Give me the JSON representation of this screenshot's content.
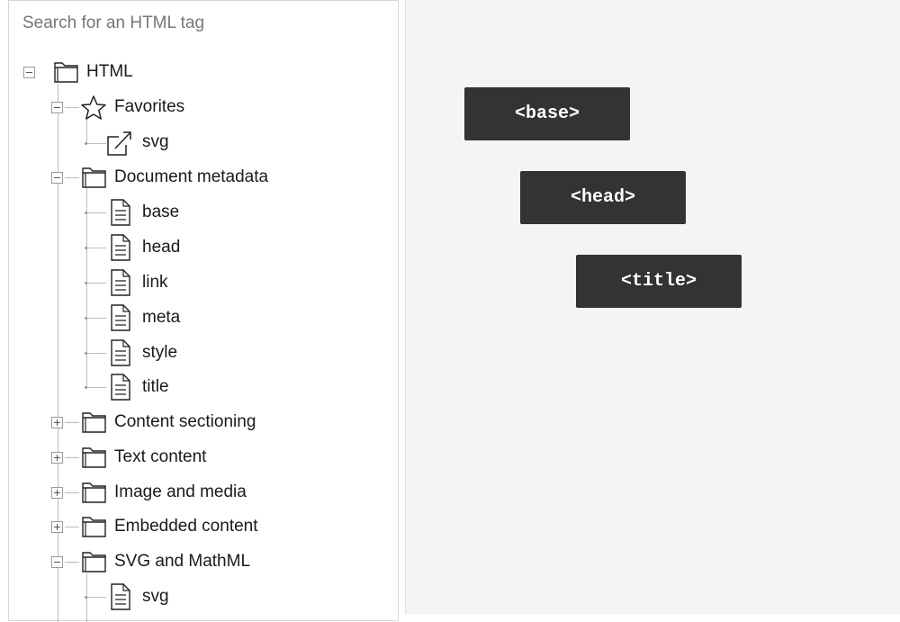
{
  "search": {
    "placeholder": "Search for an HTML tag"
  },
  "tree": {
    "root": {
      "label": "HTML",
      "state": "expanded",
      "icon": "folder-icon"
    },
    "groups": [
      {
        "label": "Favorites",
        "state": "expanded",
        "icon": "star-icon",
        "items": [
          {
            "label": "svg",
            "icon": "share-icon"
          }
        ]
      },
      {
        "label": "Document metadata",
        "state": "expanded",
        "icon": "folder-icon",
        "items": [
          {
            "label": "base",
            "icon": "document-icon"
          },
          {
            "label": "head",
            "icon": "document-icon"
          },
          {
            "label": "link",
            "icon": "document-icon"
          },
          {
            "label": "meta",
            "icon": "document-icon"
          },
          {
            "label": "style",
            "icon": "document-icon"
          },
          {
            "label": "title",
            "icon": "document-icon"
          }
        ]
      },
      {
        "label": "Content sectioning",
        "state": "collapsed",
        "icon": "folder-icon"
      },
      {
        "label": "Text content",
        "state": "collapsed",
        "icon": "folder-icon"
      },
      {
        "label": "Image and media",
        "state": "collapsed",
        "icon": "folder-icon"
      },
      {
        "label": "Embedded content",
        "state": "collapsed",
        "icon": "folder-icon"
      },
      {
        "label": "SVG and MathML",
        "state": "expanded",
        "icon": "folder-icon",
        "items": [
          {
            "label": "svg",
            "icon": "document-icon"
          }
        ]
      }
    ]
  },
  "canvas": {
    "blocks": [
      {
        "label": "<base>"
      },
      {
        "label": "<head>"
      },
      {
        "label": "<title>"
      }
    ]
  },
  "colors": {
    "block_bg": "#333333",
    "canvas_bg": "#f2f5f4",
    "line": "#bdbdbd"
  }
}
